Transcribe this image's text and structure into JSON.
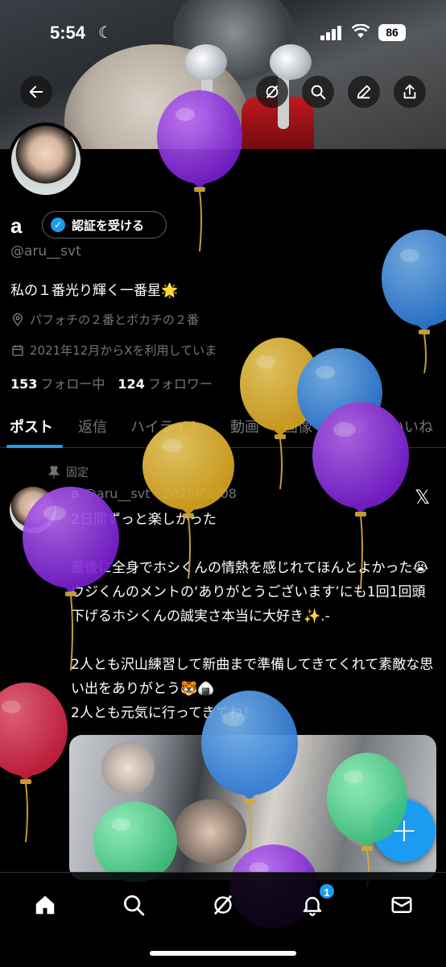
{
  "status_bar": {
    "time": "5:54",
    "battery": "86"
  },
  "profile": {
    "display_name": "a",
    "verify_button_label": "認証を受ける",
    "handle": "@aru__svt",
    "bio": "私の１番光り輝く一番星🌟",
    "location": "パフォチの２番とボカチの２番",
    "joined": "2021年12月からXを利用していま",
    "following_count": "153",
    "following_label": "フォロー中",
    "followers_count": "124",
    "followers_label": "フォロワー"
  },
  "tabs": [
    {
      "label": "ポスト",
      "active": true
    },
    {
      "label": "返信"
    },
    {
      "label": "ハイライト"
    },
    {
      "label": "動画"
    },
    {
      "label": "画像"
    },
    {
      "label": "記事"
    },
    {
      "label": "いいね"
    }
  ],
  "pinned_post": {
    "pinned_label": "固定",
    "author": "a",
    "handle_date": "@aru__svt · 2025/08/08",
    "body": "2日間ずっと楽しかった\n\n最後に全身でホシくんの情熱を感じれてほんとよかった😭\nウジくんのメントの‘ありがとうございます’にも1回1回頭下げるホシくんの誠実さ本当に大好き✨.-\n\n2人とも沢山練習して新曲まで準備してきてくれて素敵な思い出をありがとう🐯🍙\n2人とも元気に行ってきてね！"
  },
  "fab_label": "+",
  "notifications_badge": "1",
  "icons": {
    "back": "back-arrow-icon",
    "grok": "grok-icon",
    "search": "search-icon",
    "edit": "edit-icon",
    "share": "share-icon",
    "location": "location-pin-icon",
    "calendar": "calendar-icon",
    "pin": "pin-icon",
    "x": "x-logo-icon",
    "home": "home-icon",
    "bell": "bell-icon",
    "mail": "mail-icon"
  },
  "colors": {
    "accent": "#1d9bf0",
    "balloon_purple": "#8a2be2",
    "balloon_blue": "#3d8fe0",
    "balloon_yellow": "#e6b82e",
    "balloon_green": "#4fd08a",
    "balloon_red": "#e0304a"
  }
}
